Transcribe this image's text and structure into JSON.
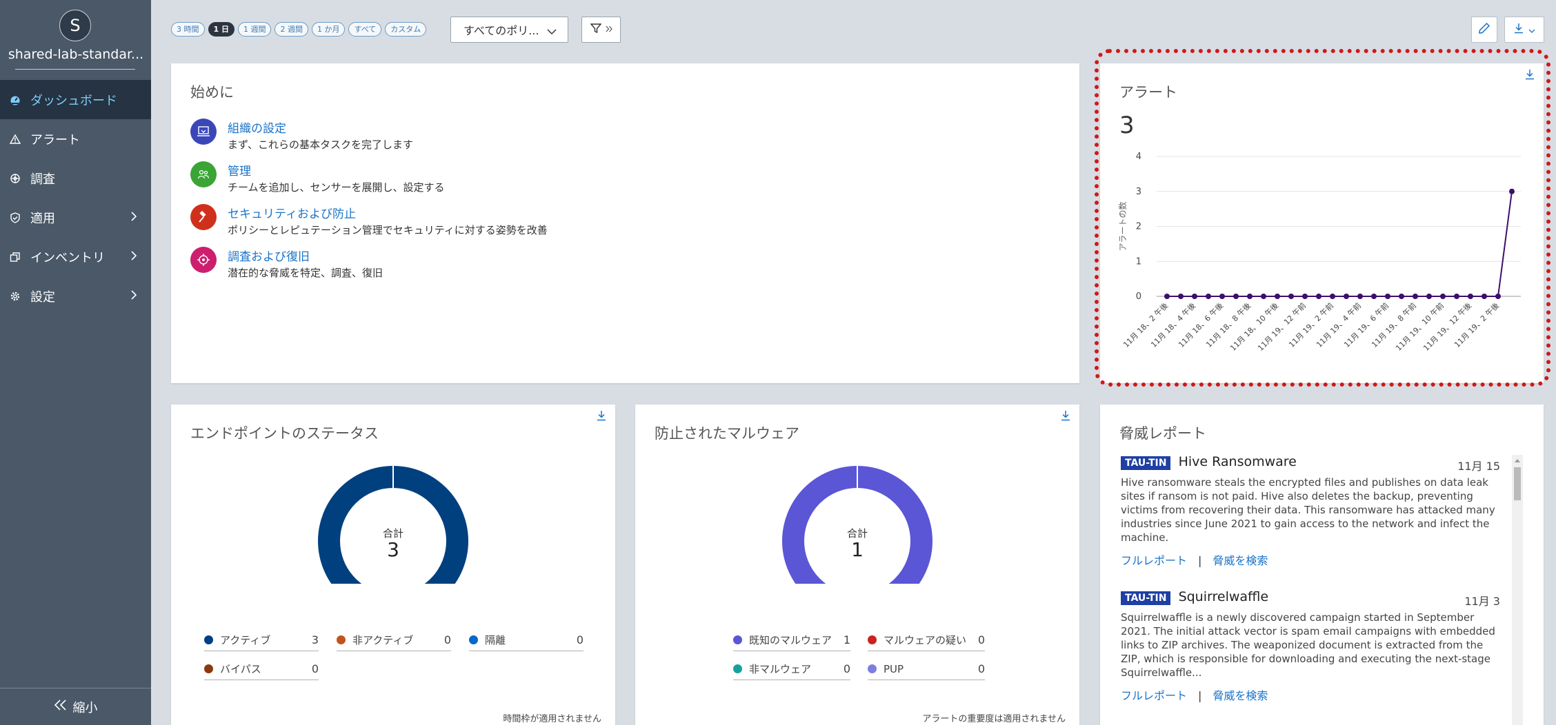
{
  "sidebar": {
    "avatar_letter": "S",
    "org_name": "shared-lab-standar...",
    "items": [
      {
        "label": "ダッシュボード",
        "icon": "dashboard-icon"
      },
      {
        "label": "アラート",
        "icon": "warning-icon"
      },
      {
        "label": "調査",
        "icon": "investigate-icon"
      },
      {
        "label": "適用",
        "icon": "shield-icon"
      },
      {
        "label": "インベントリ",
        "icon": "inventory-icon"
      },
      {
        "label": "設定",
        "icon": "gear-icon"
      }
    ],
    "collapse_label": "縮小"
  },
  "toolbar": {
    "time_ranges": [
      "3 時間",
      "1 日",
      "1 週間",
      "2 週間",
      "1 か月",
      "すべて",
      "カスタム"
    ],
    "active_range": "1 日",
    "policy_select": "すべてのポリ..."
  },
  "getting_started": {
    "title": "始めに",
    "items": [
      {
        "link": "組織の設定",
        "desc": "まず、これらの基本タスクを完了します",
        "color": "#3b47b8"
      },
      {
        "link": "管理",
        "desc": "チームを追加し、センサーを展開し、設定する",
        "color": "#3aa535"
      },
      {
        "link": "セキュリティおよび防止",
        "desc": "ポリシーとレピュテーション管理でセキュリティに対する姿勢を改善",
        "color": "#d0301b"
      },
      {
        "link": "調査および復旧",
        "desc": "潜在的な脅威を特定、調査、復旧",
        "color": "#cc1f6e"
      }
    ]
  },
  "alerts": {
    "title": "アラート",
    "count": "3"
  },
  "chart_data": {
    "type": "line",
    "title": "アラート",
    "ylabel": "アラートの数",
    "ylim": [
      0,
      4
    ],
    "yticks": [
      "0",
      "1",
      "2",
      "3",
      "4"
    ],
    "xtick_labels": [
      "11月 18、2 午後",
      "11月 18、4 午後",
      "11月 18、6 午後",
      "11月 18、8 午後",
      "11月 18、10 午後",
      "11月 19、12 午前",
      "11月 19、2 午前",
      "11月 19、4 午前",
      "11月 19、6 午前",
      "11月 19、8 午前",
      "11月 19、10 午前",
      "11月 19、12 午後",
      "11月 19、2 午後"
    ],
    "values": [
      0,
      0,
      0,
      0,
      0,
      0,
      0,
      0,
      0,
      0,
      0,
      0,
      0,
      0,
      0,
      0,
      0,
      0,
      0,
      0,
      0,
      0,
      0,
      0,
      0,
      3
    ],
    "color": "#3d0f6b"
  },
  "endpoint_status": {
    "title": "エンドポイントのステータス",
    "total_label": "合計",
    "total": "3",
    "legend": [
      {
        "label": "アクティブ",
        "value": "3",
        "color": "#003f82"
      },
      {
        "label": "非アクティブ",
        "value": "0",
        "color": "#c1541a"
      },
      {
        "label": "隔離",
        "value": "0",
        "color": "#0069c9"
      },
      {
        "label": "バイパス",
        "value": "0",
        "color": "#8b3a0e"
      }
    ],
    "footnote": "時間枠が適用されません",
    "ring_color": "#00407f"
  },
  "malware": {
    "title": "防止されたマルウェア",
    "total_label": "合計",
    "total": "1",
    "legend": [
      {
        "label": "既知のマルウェア",
        "value": "1",
        "color": "#5a56d6"
      },
      {
        "label": "マルウェアの疑い",
        "value": "0",
        "color": "#c9231f"
      },
      {
        "label": "非マルウェア",
        "value": "0",
        "color": "#17a0a0"
      },
      {
        "label": "PUP",
        "value": "0",
        "color": "#7b7fe0"
      }
    ],
    "footnote": "アラートの重要度は適用されません",
    "ring_color": "#5a56d6"
  },
  "threat_report": {
    "title": "脅威レポート",
    "items": [
      {
        "tag": "TAU-TIN",
        "name": "Hive Ransomware",
        "date": "11月 15",
        "body": "Hive ransomware steals the encrypted files and publishes on data leak sites if ransom is not paid. Hive also deletes the backup, preventing victims from recovering their data. This ransomware has attacked many industries since June 2021 to gain access to the network and infect the machine.",
        "link1": "フルレポート",
        "sep": "|",
        "link2": "脅威を検索"
      },
      {
        "tag": "TAU-TIN",
        "name": "Squirrelwaffle",
        "date": "11月 3",
        "body": "Squirrelwaffle is a newly discovered campaign started in September 2021. The initial attack vector is spam email campaigns with embedded links to ZIP archives. The weaponized document is extracted from the ZIP, which is responsible for downloading and executing the next-stage Squirrelwaffle...",
        "link1": "フルレポート",
        "sep": "|",
        "link2": "脅威を検索"
      }
    ]
  },
  "colors": {
    "accent": "#1a73c9",
    "sidebar": "#4a5868",
    "sidebar_active": "#263342",
    "highlight": "#d01818"
  }
}
